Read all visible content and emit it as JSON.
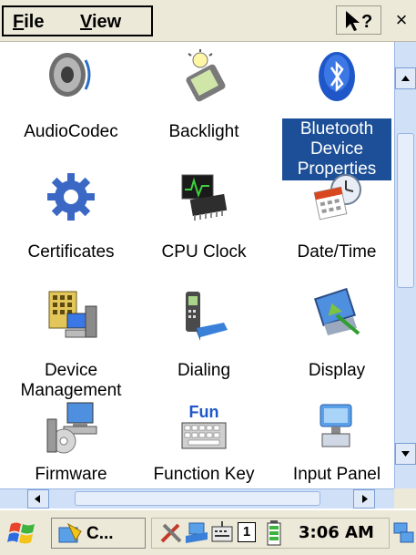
{
  "menu": {
    "file_label": "File",
    "file_accel": "F",
    "file_rest": "ile",
    "view_label": "View",
    "view_accel": "V",
    "view_rest": "iew",
    "help_icon": "pointer-question-icon",
    "close_label": "×"
  },
  "items": [
    {
      "label": "AudioCodec",
      "icon": "speaker-icon"
    },
    {
      "label": "Backlight",
      "icon": "backlight-bulb-icon"
    },
    {
      "label": "Bluetooth Device Properties",
      "lines": [
        "Bluetooth",
        "Device",
        "Properties"
      ],
      "icon": "bluetooth-icon",
      "selected": true
    },
    {
      "label": "Certificates",
      "icon": "gear-icon"
    },
    {
      "label": "CPU Clock",
      "icon": "cpu-chip-icon"
    },
    {
      "label": "Date/Time",
      "icon": "calendar-clock-icon"
    },
    {
      "label": "Device Management",
      "lines": [
        "Device",
        "Management"
      ],
      "icon": "device-management-icon"
    },
    {
      "label": "Dialing",
      "icon": "phone-dialing-icon"
    },
    {
      "label": "Display",
      "icon": "display-icon"
    },
    {
      "label": "Firmware",
      "icon": "firmware-icon"
    },
    {
      "label": "Function Key",
      "icon": "fun-keyboard-icon",
      "icon_text": "Fun"
    },
    {
      "label": "Input Panel",
      "icon": "input-panel-icon"
    }
  ],
  "taskbar": {
    "start_icon": "windows-flag-icon",
    "task_label": "C...",
    "tray_number": "1",
    "clock": "3:06 AM"
  },
  "colors": {
    "selection": "#1c4f97",
    "menubar": "#ece9d8",
    "scrollbar": "#cfe0f7"
  }
}
